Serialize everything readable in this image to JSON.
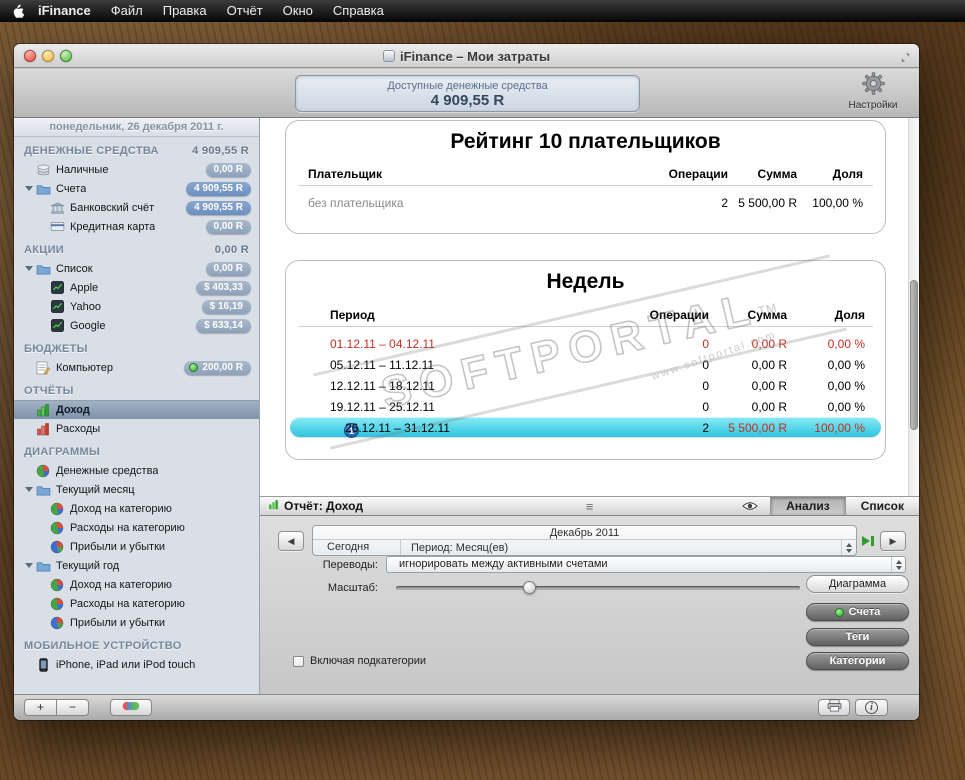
{
  "colors": {
    "selection_cyan": "#3ecfe6",
    "negative_red": "#c23023",
    "badge_gray": "#8ca1ba",
    "badge_blue": "#6c8ec0",
    "budget_green": "#2aa52a"
  },
  "icons": {
    "handle": "≡",
    "arrow_left": "◀",
    "arrow_right": "▶",
    "info": "i",
    "gear": "gear-svg",
    "eye": "eye-svg",
    "printer": "printer-svg"
  },
  "menubar": {
    "app_name": "iFinance",
    "items": [
      "Файл",
      "Правка",
      "Отчёт",
      "Окно",
      "Справка"
    ]
  },
  "window": {
    "title": "iFinance – Мои затраты"
  },
  "toolbar": {
    "funds_label": "Доступные денежные средства",
    "funds_value": "4 909,55 R",
    "settings_label": "Настройки"
  },
  "sidebar": {
    "date_header": "понедельник, 26 декабря 2011 г.",
    "sections": [
      {
        "title": "ДЕНЕЖНЫЕ СРЕДСТВА",
        "value": "4 909,55 R"
      },
      {
        "title": "АКЦИИ",
        "value": "0,00 R"
      },
      {
        "title": "БЮДЖЕТЫ",
        "value": ""
      },
      {
        "title": "ОТЧЁТЫ",
        "value": ""
      },
      {
        "title": "ДИАГРАММЫ",
        "value": ""
      },
      {
        "title": "МОБИЛЬНОЕ УСТРОЙСТВО",
        "value": ""
      }
    ],
    "items": {
      "cash": {
        "label": "Наличные",
        "badge": "0,00 R"
      },
      "accounts": {
        "label": "Счета",
        "badge": "4 909,55 R"
      },
      "bank": {
        "label": "Банковский счёт",
        "badge": "4 909,55 R"
      },
      "credit": {
        "label": "Кредитная карта",
        "badge": "0,00 R"
      },
      "stocks_list": {
        "label": "Список",
        "badge": "0,00 R"
      },
      "apple": {
        "label": "Apple",
        "badge": "$ 403,33"
      },
      "yahoo": {
        "label": "Yahoo",
        "badge": "$ 16,19"
      },
      "google": {
        "label": "Google",
        "badge": "$ 633,14"
      },
      "computer": {
        "label": "Компьютер",
        "badge": "200,00 R"
      },
      "income": {
        "label": "Доход"
      },
      "expenses": {
        "label": "Расходы"
      },
      "money": {
        "label": "Денежные средства"
      },
      "cur_month": {
        "label": "Текущий месяц"
      },
      "m_income": {
        "label": "Доход на категорию"
      },
      "m_expenses": {
        "label": "Расходы на категорию"
      },
      "m_pl": {
        "label": "Прибыли и убытки"
      },
      "cur_year": {
        "label": "Текущий год"
      },
      "y_income": {
        "label": "Доход на категорию"
      },
      "y_expenses": {
        "label": "Расходы на категорию"
      },
      "y_pl": {
        "label": "Прибыли и убытки"
      },
      "iphone": {
        "label": "iPhone, iPad или iPod touch"
      }
    }
  },
  "report": {
    "payers_card": {
      "title": "Рейтинг 10 плательщиков",
      "headers": [
        "Плательщик",
        "Операции",
        "Сумма",
        "Доля"
      ],
      "rows": [
        {
          "name": "без плательщика",
          "ops": "2",
          "sum": "5 500,00 R",
          "share": "100,00 %"
        }
      ]
    },
    "weeks_card": {
      "title": "Недель",
      "headers": [
        "Период",
        "Операции",
        "Сумма",
        "Доля"
      ],
      "rows": [
        {
          "period": "01.12.11 – 04.12.11",
          "ops": "0",
          "sum": "0,00 R",
          "share": "0,00 %"
        },
        {
          "period": "05.12.11 – 11.12.11",
          "ops": "0",
          "sum": "0,00 R",
          "share": "0,00 %"
        },
        {
          "period": "12.12.11 – 18.12.11",
          "ops": "0",
          "sum": "0,00 R",
          "share": "0,00 %"
        },
        {
          "period": "19.12.11 – 25.12.11",
          "ops": "0",
          "sum": "0,00 R",
          "share": "0,00 %"
        },
        {
          "period": "26.12.11 – 31.12.11",
          "ops": "2",
          "sum": "5 500,00 R",
          "share": "100,00 %",
          "rank": "1"
        }
      ]
    },
    "watermark": {
      "text": "SOFTPORTAL",
      "tm": "TM",
      "url": "www.softportal.com"
    }
  },
  "statusbar": {
    "title": "Отчёт: Доход",
    "tabs": [
      "Анализ",
      "Список"
    ]
  },
  "controls": {
    "month": "Декабрь 2011",
    "today": "Сегодня",
    "period": "Период: Месяц(ев)",
    "transfers_label": "Переводы:",
    "transfers_value": "игнорировать между активными счетами",
    "scale_label": "Масштаб:",
    "diagram": "Диаграмма",
    "accounts": "Счета",
    "tags": "Теги",
    "categories": "Категории",
    "include_sub": "Включая подкатегории"
  },
  "bottombar": {
    "add": "+",
    "remove": "−",
    "info": "i"
  }
}
